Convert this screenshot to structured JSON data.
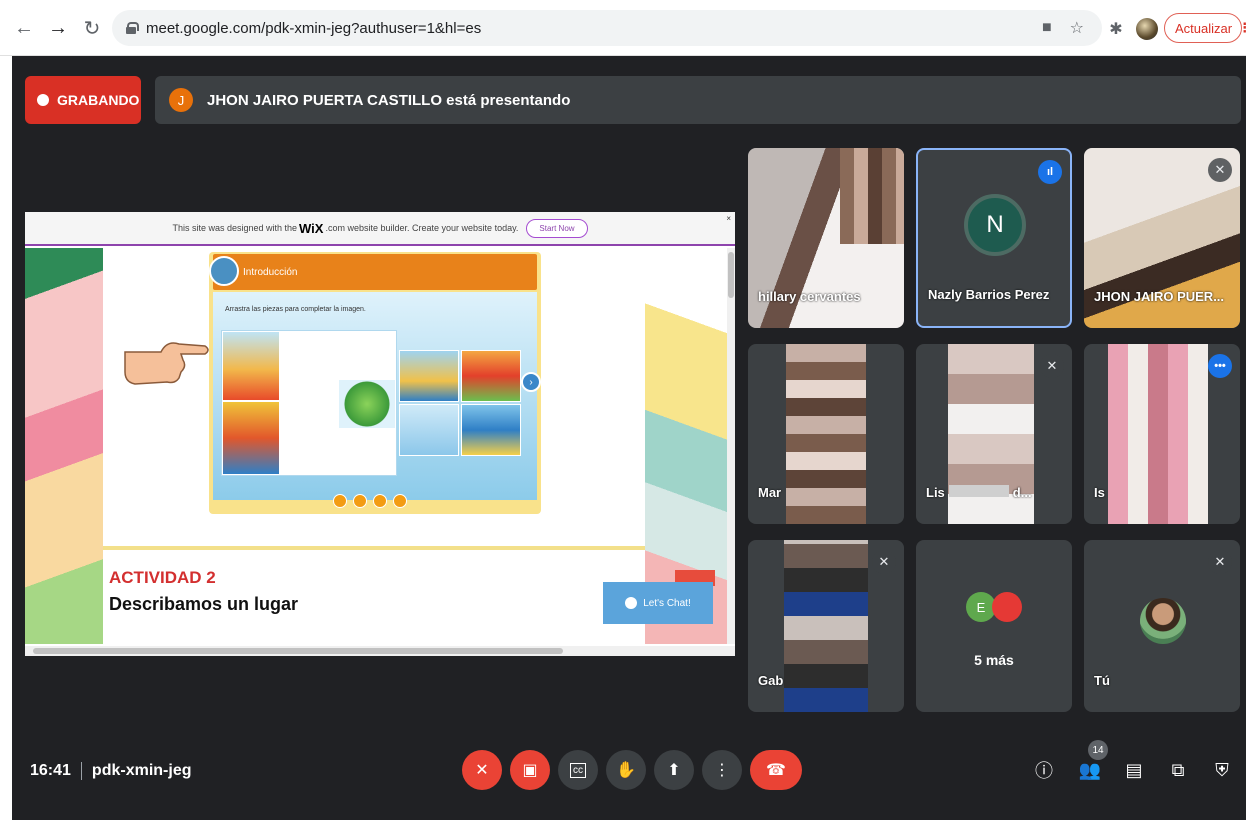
{
  "browser": {
    "url": "meet.google.com/pdk-xmin-jeg?authuser=1&hl=es",
    "update_label": "Actualizar",
    "icons": [
      "back-icon",
      "forward-icon",
      "reload-icon",
      "lock-icon",
      "camera-blocked-icon",
      "star-icon",
      "extensions-icon",
      "profile-avatar",
      "menu-dots-icon"
    ]
  },
  "meet": {
    "recording_label": "GRABANDO",
    "presenter_initial": "J",
    "presenting_text": "JHON JAIRO PUERTA CASTILLO está presentando",
    "meeting_time": "16:41",
    "meeting_code": "pdk-xmin-jeg",
    "participant_count": "14"
  },
  "presentation": {
    "wix_text_pre": "This site was designed with the",
    "wix_logo": "WiX",
    "wix_text_post": ".com website builder. Create your website today.",
    "start_now": "Start Now",
    "close_mark": "×",
    "puzzle_title": "Introducción",
    "puzzle_instruction": "Arrastra las piezas para completar la imagen.",
    "activity_title": "ACTIVIDAD 2",
    "activity_subtitle": "Describamos un lugar",
    "chat_label": "Let's Chat!"
  },
  "tiles": [
    {
      "name": "hillary cervantes",
      "state": "none"
    },
    {
      "name": "Nazly Barrios Perez",
      "initial": "N",
      "state": "speaking"
    },
    {
      "name": "JHON JAIRO PUER...",
      "state": "muted"
    },
    {
      "name": "Mar",
      "state": "none"
    },
    {
      "name": "Lis",
      "name_tail": "d...",
      "state": "muted"
    },
    {
      "name": "Is",
      "state": "talking"
    },
    {
      "name": "Gab",
      "state": "muted"
    },
    {
      "label": "5 más",
      "initial": "E",
      "state": "none"
    },
    {
      "name": "Tú",
      "state": "muted"
    }
  ],
  "colors": {
    "meet_bg": "#202124",
    "tile_bg": "#3c4043",
    "recording_red": "#d93025",
    "hangup_red": "#ea4335",
    "speaking_blue": "#8ab4f8"
  }
}
